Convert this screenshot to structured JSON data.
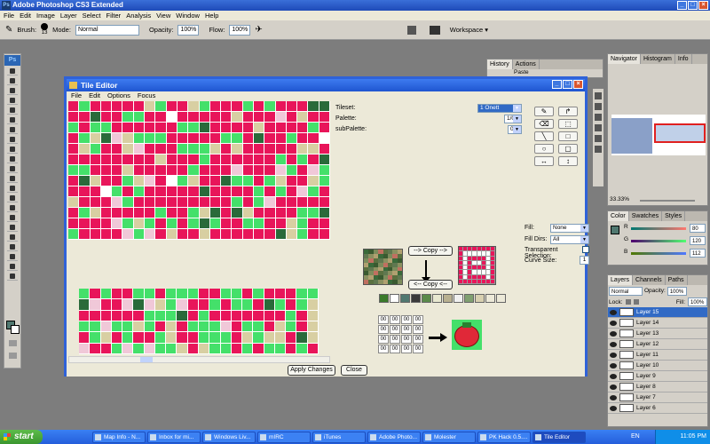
{
  "app": {
    "title": "Adobe Photoshop CS3 Extended",
    "menu": [
      "File",
      "Edit",
      "Image",
      "Layer",
      "Select",
      "Filter",
      "Analysis",
      "View",
      "Window",
      "Help"
    ],
    "options": {
      "brush_label": "Brush:",
      "brush_size": "13",
      "mode_label": "Mode:",
      "mode_value": "Normal",
      "opacity_label": "Opacity:",
      "opacity_value": "100%",
      "flow_label": "Flow:",
      "flow_value": "100%",
      "workspace_label": "Workspace ▾"
    },
    "tools_logo": "Ps"
  },
  "tile_editor": {
    "title": "Tile Editor",
    "menu": [
      "File",
      "Edit",
      "Options",
      "Focus"
    ],
    "tileset_label": "Tileset:",
    "tileset_value": "1 Onett",
    "palette_label": "Palette:",
    "palette_value": "1/0",
    "subpalette_label": "subPalette:",
    "subpalette_value": "0",
    "fill_label": "Fill:",
    "fill_value": "None",
    "fill_dirs_label": "Fill Dirs:",
    "fill_dirs_value": "All",
    "transparent_label": "Transparent Selection:",
    "curve_label": "Curve Size:",
    "curve_value": "1",
    "copy_right": "--> Copy -->",
    "copy_left": "<-- Copy <--",
    "apply_button": "Apply Changes",
    "close_button": "Close",
    "num_cells": [
      "00",
      "00",
      "00",
      "00",
      "00",
      "00",
      "00",
      "00",
      "00",
      "00",
      "00",
      "00",
      "00",
      "00",
      "00",
      "00"
    ],
    "tool_icons": [
      "pencil-icon",
      "fill-icon",
      "eraser-icon",
      "select-icon",
      "line-icon",
      "rect-icon",
      "ellipse-icon",
      "rounded-rect-icon",
      "flip-h-icon",
      "flip-v-icon"
    ]
  },
  "panels": {
    "history": {
      "tabs": [
        "History",
        "Actions"
      ],
      "item": "Paste"
    },
    "navigator": {
      "tabs": [
        "Navigator",
        "Histogram",
        "Info"
      ],
      "zoom": "33.33%"
    },
    "color": {
      "tabs": [
        "Color",
        "Swatches",
        "Styles"
      ],
      "r_label": "R",
      "r_value": "80",
      "g_label": "G",
      "g_value": "120",
      "b_label": "B",
      "b_value": "112"
    },
    "layers": {
      "tabs": [
        "Layers",
        "Channels",
        "Paths"
      ],
      "mode": "Normal",
      "opacity_label": "Opacity:",
      "opacity_value": "100%",
      "lock_label": "Lock:",
      "fill_label": "Fill:",
      "fill_value": "100%",
      "items": [
        "Layer 15",
        "Layer 14",
        "Layer 13",
        "Layer 12",
        "Layer 11",
        "Layer 10",
        "Layer 9",
        "Layer 8",
        "Layer 7",
        "Layer 6"
      ]
    }
  },
  "taskbar": {
    "start": "start",
    "tasks": [
      "Map Info - N...",
      "Inbox for mi...",
      "Windows Liv...",
      "mIRC",
      "iTunes",
      "Adobe Photo...",
      "Molester",
      "PK Hack 0.5....",
      "Tile Editor"
    ],
    "lang": "EN",
    "time": "11:05 PM"
  },
  "colors": {
    "grass_green": "#44e06a",
    "tile_pink": "#e8155a",
    "tile_tan": "#d8cfa2",
    "titlebar_blue": "#245edb"
  }
}
